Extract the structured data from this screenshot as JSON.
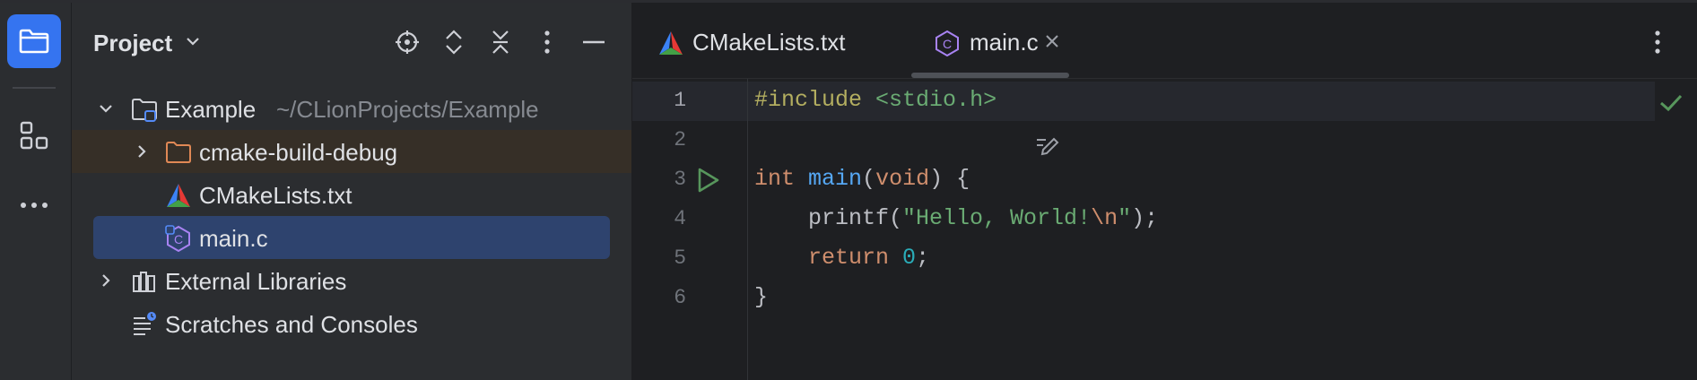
{
  "window": {
    "accent": "#3574f0"
  },
  "stripe": {
    "items": [
      {
        "icon": "folder-icon",
        "active": true
      },
      {
        "icon": "structure-icon",
        "active": false
      },
      {
        "icon": "more-icon",
        "active": false
      }
    ]
  },
  "project_panel": {
    "title": "Project",
    "header_icons": [
      "locate-icon",
      "expand-all-icon",
      "collapse-all-icon",
      "options-icon",
      "hide-icon"
    ],
    "tree": [
      {
        "label": "Example",
        "path": "~/CLionProjects/Example",
        "icon": "project-folder-icon",
        "expanded": true
      },
      {
        "label": "cmake-build-debug",
        "icon": "folder-icon",
        "expanded": false,
        "highlighted": true
      },
      {
        "label": "CMakeLists.txt",
        "icon": "cmake-icon"
      },
      {
        "label": "main.c",
        "icon": "c-file-icon",
        "selected": true
      },
      {
        "label": "External Libraries",
        "icon": "library-icon",
        "expanded": false
      },
      {
        "label": "Scratches and Consoles",
        "icon": "scratches-icon"
      }
    ]
  },
  "editor": {
    "tabs": [
      {
        "label": "CMakeLists.txt",
        "icon": "cmake-icon",
        "active": false
      },
      {
        "label": "main.c",
        "icon": "c-file-icon",
        "active": true,
        "closable": true
      }
    ],
    "line_numbers": [
      "1",
      "2",
      "3",
      "4",
      "5",
      "6"
    ],
    "status": "inspection-ok-icon"
  }
}
